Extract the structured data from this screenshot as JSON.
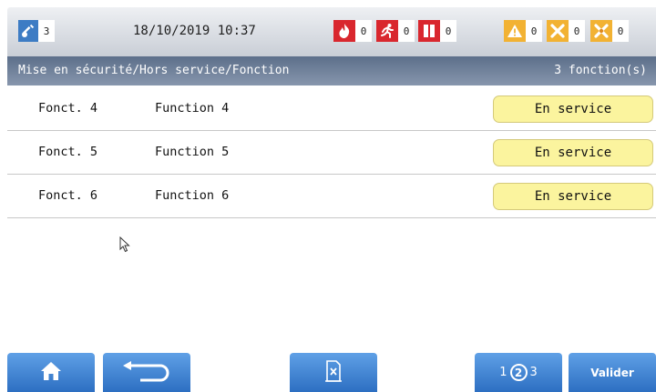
{
  "header": {
    "key_count": "3",
    "datetime": "18/10/2019 10:37",
    "alarms": [
      {
        "icon": "fire-icon",
        "count": "0",
        "color": "#d9272e"
      },
      {
        "icon": "evacuation-icon",
        "count": "0",
        "color": "#d9272e"
      },
      {
        "icon": "door-icon",
        "count": "0",
        "color": "#d9272e"
      },
      {
        "icon": "warning-icon",
        "count": "0",
        "color": "#f2b233"
      },
      {
        "icon": "fault-icon",
        "count": "0",
        "color": "#f2b233"
      },
      {
        "icon": "disabled-icon",
        "count": "0",
        "color": "#f2b233"
      }
    ]
  },
  "subheader": {
    "path": "Mise en sécurité/Hors service/Fonction",
    "count": "3 fonction(s)"
  },
  "rows": [
    {
      "id": "Fonct. 4",
      "name": "Function 4",
      "status": "En service"
    },
    {
      "id": "Fonct. 5",
      "name": "Function 5",
      "status": "En service"
    },
    {
      "id": "Fonct. 6",
      "name": "Function 6",
      "status": "En service"
    }
  ],
  "toolbar": {
    "home_icon": "home-icon",
    "back_icon": "back-icon",
    "clear_icon": "clear-selection-icon",
    "pager": {
      "prev": "1",
      "current": "2",
      "next": "3"
    },
    "valider_label": "Valider"
  },
  "colors": {
    "accent_blue": "#3d7cc4",
    "status_yellow": "#fbf49e",
    "alarm_red": "#d9272e",
    "fault_orange": "#f2b233"
  }
}
